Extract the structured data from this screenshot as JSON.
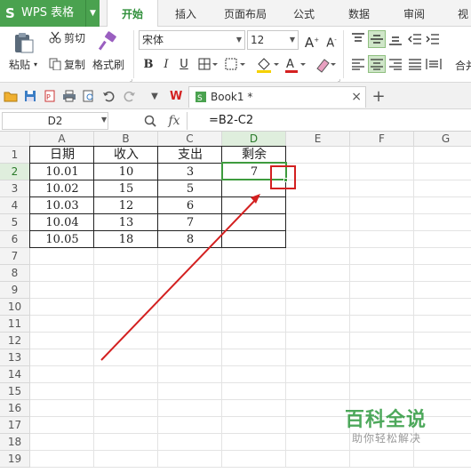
{
  "app": {
    "name": "WPS 表格",
    "logo_letter": "S"
  },
  "tabs": [
    "开始",
    "插入",
    "页面布局",
    "公式",
    "数据",
    "审阅",
    "视"
  ],
  "active_tab": "开始",
  "clipboard": {
    "paste": "粘贴",
    "cut": "剪切",
    "copy": "复制",
    "format_painter": "格式刷"
  },
  "font": {
    "name": "宋体",
    "size": "12"
  },
  "format_buttons": {
    "bold": "B",
    "italic": "I",
    "underline": "U"
  },
  "ribbon_right_label": "合并",
  "document": {
    "tab_label": "Book1 *"
  },
  "name_box": "D2",
  "formula": "=B2-C2",
  "columns": [
    "A",
    "B",
    "C",
    "D",
    "E",
    "F",
    "G"
  ],
  "rows": [
    "1",
    "2",
    "3",
    "4",
    "5",
    "6",
    "7",
    "8",
    "9",
    "10",
    "11",
    "12",
    "13",
    "14",
    "15",
    "16",
    "17",
    "18",
    "19"
  ],
  "table": {
    "headers": [
      "日期",
      "收入",
      "支出",
      "剩余"
    ],
    "data": [
      [
        "10.01",
        "10",
        "3",
        "7"
      ],
      [
        "10.02",
        "15",
        "5",
        ""
      ],
      [
        "10.03",
        "12",
        "6",
        ""
      ],
      [
        "10.04",
        "13",
        "7",
        ""
      ],
      [
        "10.05",
        "18",
        "8",
        ""
      ]
    ]
  },
  "selected_cell": "D2",
  "watermark": {
    "title": "百科全说",
    "subtitle": "助你轻松解决"
  },
  "colors": {
    "brand_green": "#4aa24f",
    "selection": "#3e9b3e",
    "annotation": "#d32020"
  }
}
